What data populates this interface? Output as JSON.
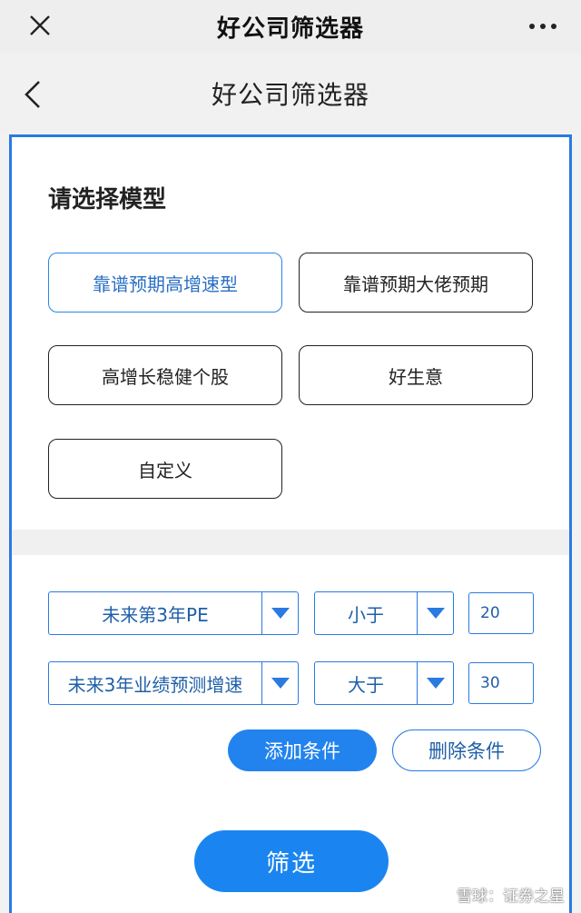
{
  "topbar": {
    "title": "好公司筛选器",
    "close_icon": "close-icon",
    "more_icon": "more-horizontal-icon"
  },
  "navbar": {
    "title": "好公司筛选器",
    "back_icon": "chevron-left-icon"
  },
  "model_section": {
    "title": "请选择模型",
    "models": [
      {
        "label": "靠谱预期高增速型",
        "selected": true
      },
      {
        "label": "靠谱预期大佬预期",
        "selected": false
      },
      {
        "label": "高增长稳健个股",
        "selected": false
      },
      {
        "label": "好生意",
        "selected": false
      },
      {
        "label": "自定义",
        "selected": false
      }
    ]
  },
  "conditions": [
    {
      "metric": "未来第3年PE",
      "operator": "小于",
      "value": "20"
    },
    {
      "metric": "未来3年业绩预测增速",
      "operator": "大于",
      "value": "30"
    }
  ],
  "actions": {
    "add_label": "添加条件",
    "delete_label": "删除条件",
    "filter_label": "筛选"
  },
  "watermark": {
    "text": "雪球：证券之星"
  },
  "colors": {
    "accent": "#2283ee",
    "border_blue": "#2a7ae2",
    "text_blue": "#1f5fa8"
  }
}
